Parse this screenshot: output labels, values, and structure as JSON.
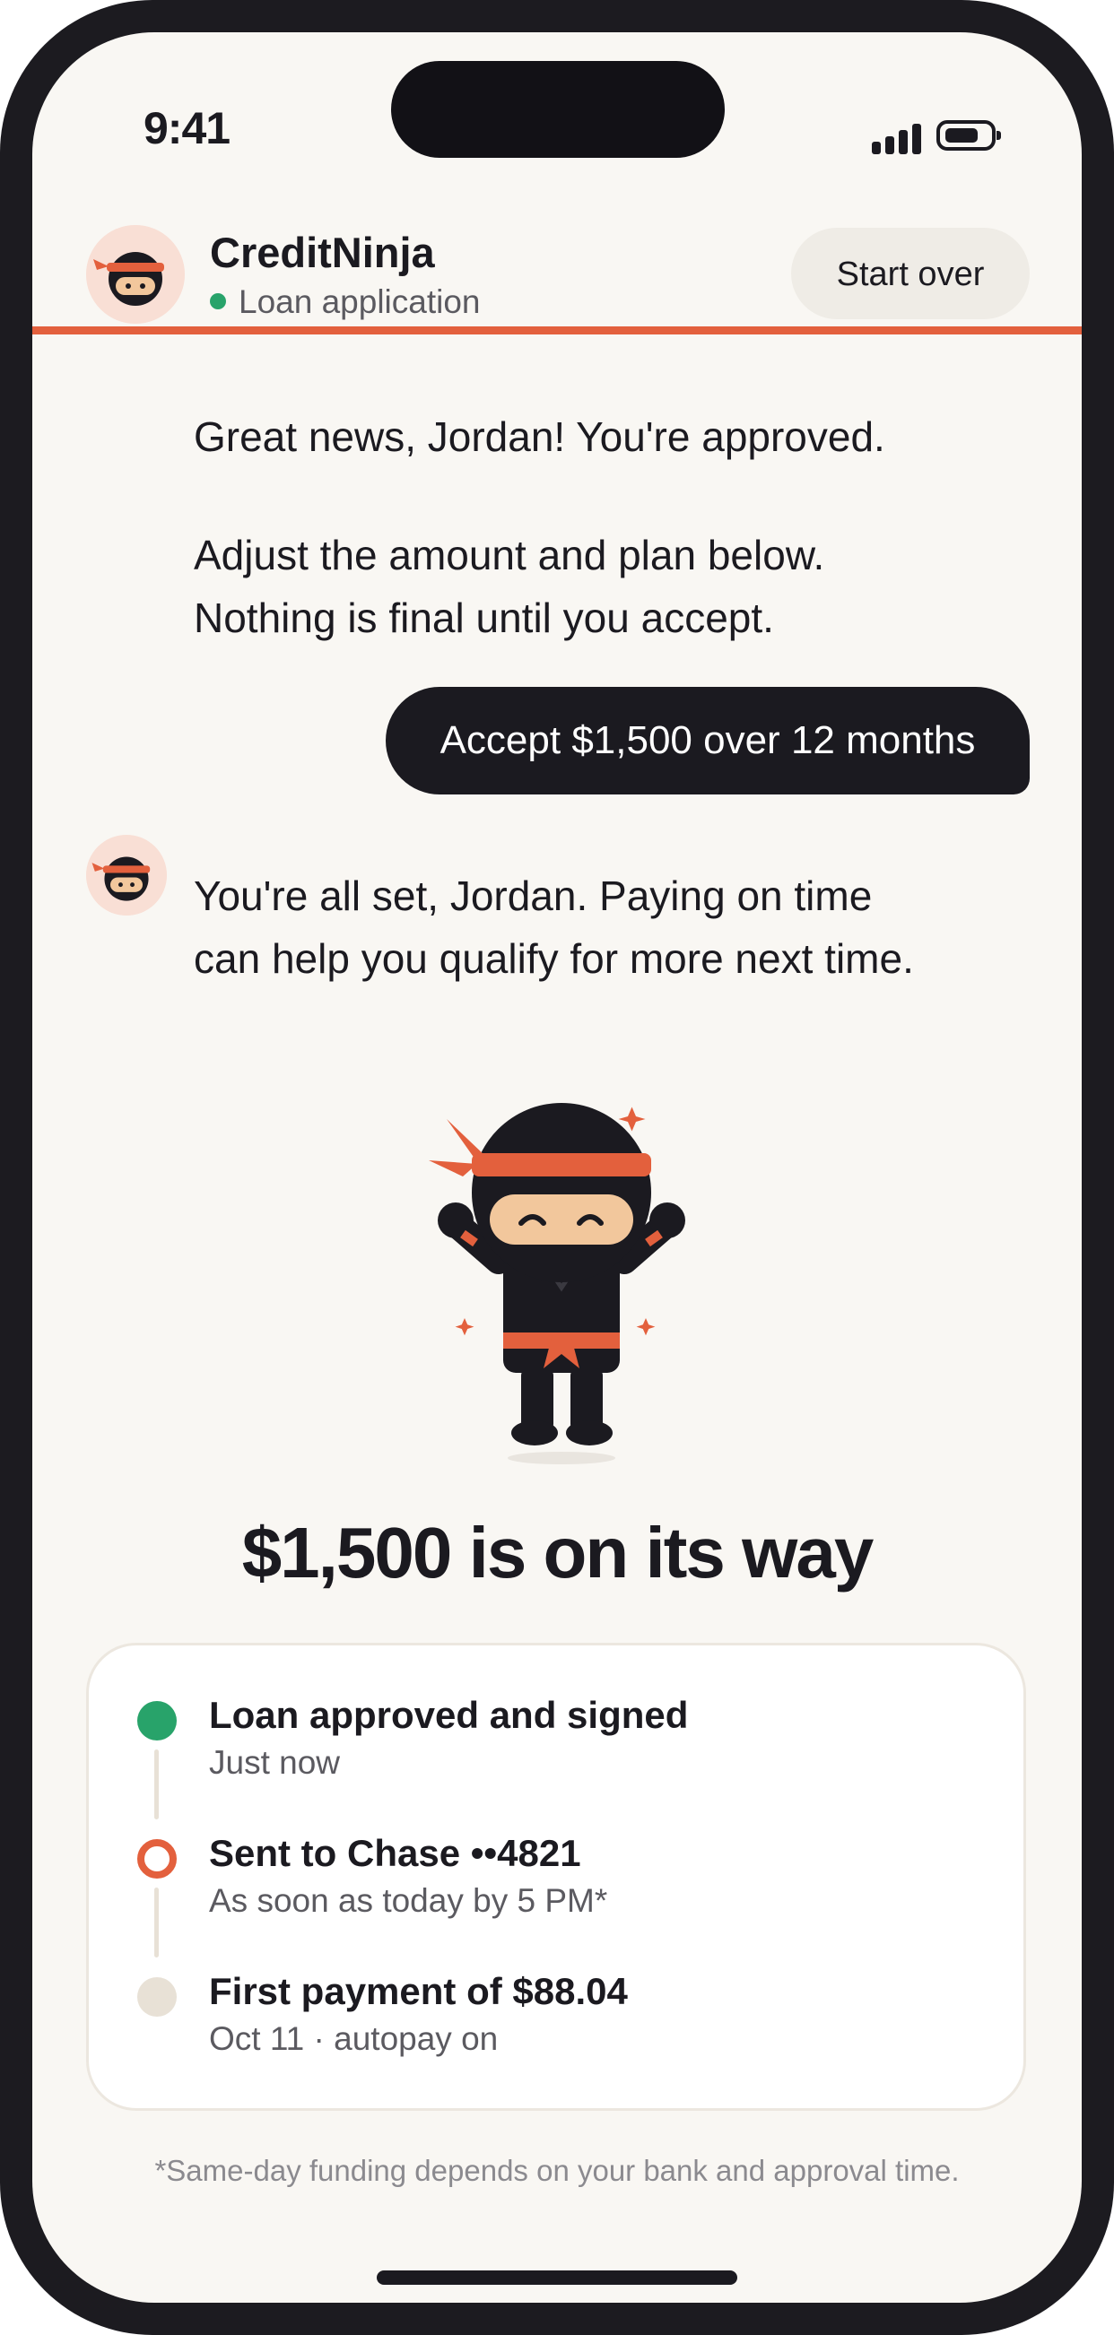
{
  "status_bar": {
    "time": "9:41"
  },
  "header": {
    "brand_name": "CreditNinja",
    "subtitle": "Loan application",
    "start_over_label": "Start over"
  },
  "chat": {
    "bot_message_1": "Great news, Jordan! You're approved.",
    "bot_message_2": "Adjust the amount and plan below. Nothing is final until you accept.",
    "user_reply": "Accept $1,500 over 12 months",
    "bot_message_3": "You're all set, Jordan. Paying on time can help you qualify for more next time."
  },
  "confirmation": {
    "headline": "$1,500 is on its way",
    "steps": [
      {
        "title": "Loan approved and signed",
        "subtitle": "Just now",
        "state": "complete"
      },
      {
        "title": "Sent to Chase ••4821",
        "subtitle": "As soon as today by 5 PM*",
        "state": "in-progress"
      },
      {
        "title": "First payment of $88.04",
        "subtitle": "Oct 11 · autopay on",
        "state": "upcoming"
      }
    ],
    "footnote": "*Same-day funding depends on your bank and approval time."
  },
  "colors": {
    "accent": "#e3603d",
    "dark": "#1b1a20",
    "success": "#28a36a",
    "background": "#f9f7f3"
  },
  "icons": [
    "ninja-avatar-icon",
    "signal-icon",
    "battery-icon",
    "ninja-mascot-illustration"
  ]
}
